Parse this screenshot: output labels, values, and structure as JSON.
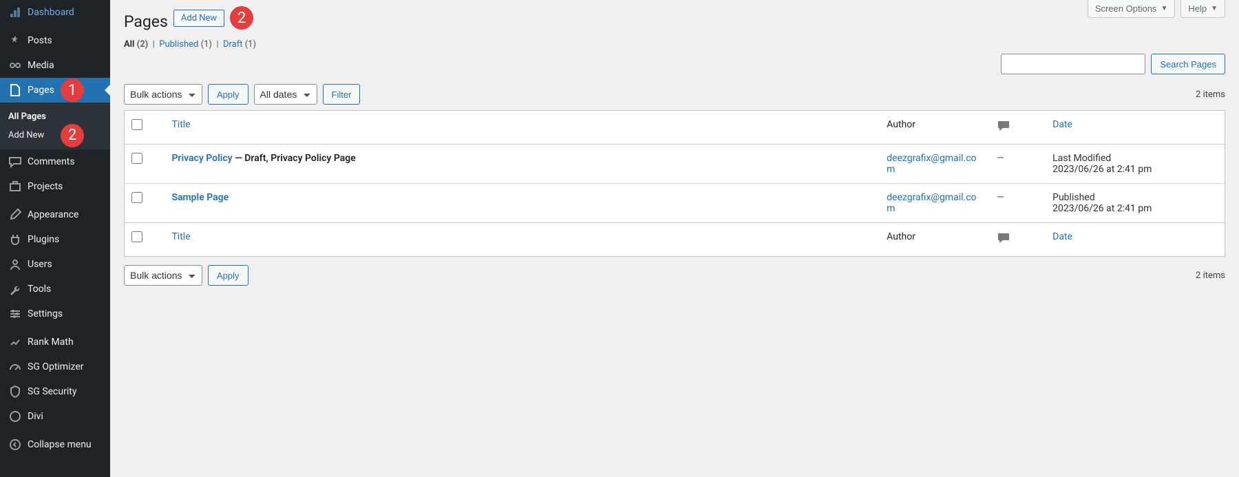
{
  "sidebar": {
    "items": [
      {
        "label": "Dashboard",
        "icon": "dashboard-icon"
      },
      {
        "label": "Posts",
        "icon": "pin-icon"
      },
      {
        "label": "Media",
        "icon": "media-icon"
      },
      {
        "label": "Pages",
        "icon": "page-icon",
        "current": true,
        "badge": "1"
      },
      {
        "label": "Comments",
        "icon": "comment-icon"
      },
      {
        "label": "Projects",
        "icon": "portfolio-icon"
      },
      {
        "label": "Appearance",
        "icon": "brush-icon"
      },
      {
        "label": "Plugins",
        "icon": "plug-icon"
      },
      {
        "label": "Users",
        "icon": "user-icon"
      },
      {
        "label": "Tools",
        "icon": "wrench-icon"
      },
      {
        "label": "Settings",
        "icon": "sliders-icon"
      },
      {
        "label": "Rank Math",
        "icon": "chart-icon"
      },
      {
        "label": "SG Optimizer",
        "icon": "speed-icon"
      },
      {
        "label": "SG Security",
        "icon": "shield-icon"
      },
      {
        "label": "Divi",
        "icon": "divi-icon"
      },
      {
        "label": "Collapse menu",
        "icon": "collapse-icon"
      }
    ],
    "submenu": [
      {
        "label": "All Pages",
        "current": true
      },
      {
        "label": "Add New",
        "badge": "2"
      }
    ]
  },
  "top": {
    "screen_options": "Screen Options",
    "help": "Help"
  },
  "header": {
    "title": "Pages",
    "add_new": "Add New",
    "badge": "2"
  },
  "filters": {
    "all_label": "All",
    "all_count": "(2)",
    "published_label": "Published",
    "published_count": "(1)",
    "draft_label": "Draft",
    "draft_count": "(1)"
  },
  "bulk": {
    "select": "Bulk actions",
    "apply": "Apply",
    "dates": "All dates",
    "filter": "Filter"
  },
  "search": {
    "value": "",
    "button": "Search Pages"
  },
  "items_text": "2 items",
  "table": {
    "headers": {
      "title": "Title",
      "author": "Author",
      "date": "Date"
    },
    "rows": [
      {
        "title": "Privacy Policy",
        "state": " — Draft, Privacy Policy Page",
        "author": "deezgrafix@gmail.com",
        "comments": "—",
        "date_line1": "Last Modified",
        "date_line2": "2023/06/26 at 2:41 pm"
      },
      {
        "title": "Sample Page",
        "state": "",
        "author": "deezgrafix@gmail.com",
        "comments": "—",
        "date_line1": "Published",
        "date_line2": "2023/06/26 at 2:41 pm"
      }
    ]
  },
  "colors": {
    "accent": "#2271b1",
    "badge": "#e23e3d"
  }
}
